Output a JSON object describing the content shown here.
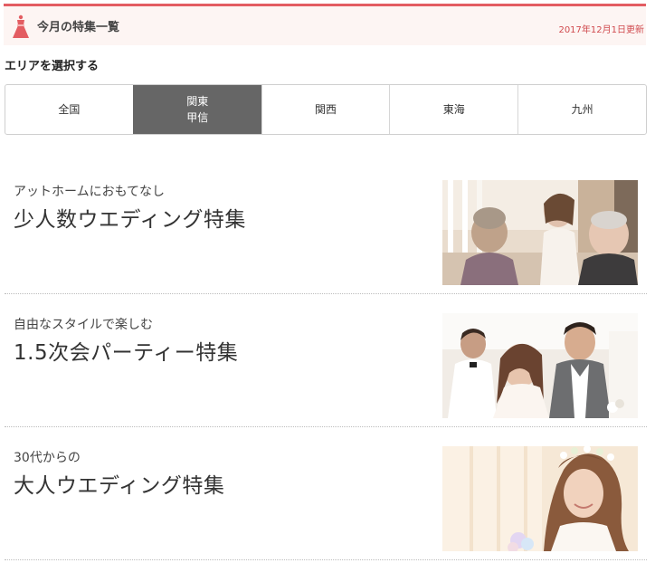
{
  "header": {
    "icon": "dress-icon",
    "title": "今月の特集一覧",
    "date": "2017年12月1日更新",
    "accent": "#e35d62"
  },
  "area": {
    "heading": "エリアを選択する",
    "tabs": [
      {
        "label": "全国",
        "active": false
      },
      {
        "label": "関東\n甲信",
        "active": true
      },
      {
        "label": "関西",
        "active": false
      },
      {
        "label": "東海",
        "active": false
      },
      {
        "label": "九州",
        "active": false
      }
    ]
  },
  "features": [
    {
      "sub": "アットホームにおもてなし",
      "title": "少人数ウエディング特集",
      "image": "wedding-guests-photo"
    },
    {
      "sub": "自由なスタイルで楽しむ",
      "title": "1.5次会パーティー特集",
      "image": "party-couple-photo"
    },
    {
      "sub": "30代からの",
      "title": "大人ウエディング特集",
      "image": "bride-portrait-photo"
    }
  ]
}
